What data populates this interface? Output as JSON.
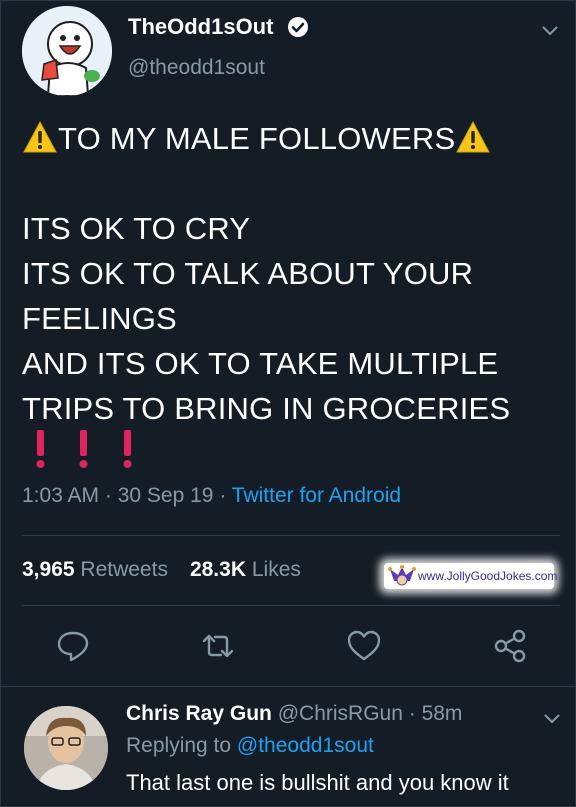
{
  "theme": {
    "background": "#141d26",
    "text": "#ffffff",
    "muted": "#8899a6",
    "link": "#1da1f2",
    "warning": "#f5c518",
    "alert": "#e0245e"
  },
  "tweet": {
    "display_name": "TheOdd1sOut",
    "handle": "@theodd1sout",
    "verified": true,
    "warning_line": "TO MY MALE FOLLOWERS",
    "lines": [
      "ITS OK TO CRY",
      "ITS OK TO TALK ABOUT YOUR",
      "FEELINGS",
      "AND ITS OK TO TAKE MULTIPLE",
      "TRIPS TO BRING IN GROCERIES"
    ],
    "time": "1:03 AM",
    "date": "30 Sep 19",
    "source": "Twitter for Android",
    "retweet_count": "3,965",
    "retweet_label": "Retweets",
    "like_count": "28.3K",
    "like_label": "Likes",
    "actions": [
      "reply-icon",
      "retweet-icon",
      "like-icon",
      "share-icon"
    ]
  },
  "watermark": {
    "text": "www.JollyGoodJokes.com"
  },
  "reply": {
    "display_name": "Chris Ray Gun",
    "handle": "@ChrisRGun",
    "time": "58m",
    "replying_prefix": "Replying to",
    "replying_to": "@theodd1sout",
    "text": "That last one is bullshit and you know it"
  }
}
